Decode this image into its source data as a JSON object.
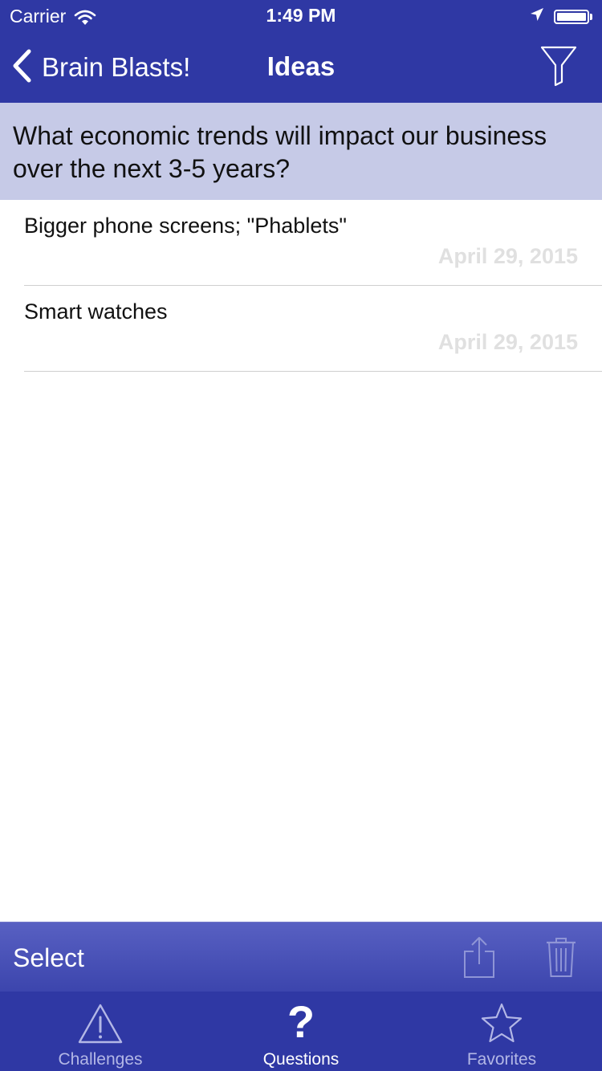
{
  "status_bar": {
    "carrier": "Carrier",
    "time": "1:49 PM",
    "battery_level": 1.0
  },
  "nav": {
    "back_label": "Brain Blasts!",
    "title": "Ideas"
  },
  "question": {
    "text": "What economic trends will impact our business over the next 3-5 years?"
  },
  "ideas": [
    {
      "text": "Bigger phone screens; \"Phablets\"",
      "date": "April 29, 2015"
    },
    {
      "text": "Smart watches",
      "date": "April 29, 2015"
    }
  ],
  "toolbar": {
    "select_label": "Select",
    "share_icon": "share-icon",
    "trash_icon": "trash-icon"
  },
  "tabs": [
    {
      "label": "Challenges",
      "icon": "warning-icon",
      "active": false
    },
    {
      "label": "Questions",
      "icon": "question-icon",
      "active": true
    },
    {
      "label": "Favorites",
      "icon": "star-icon",
      "active": false
    }
  ],
  "colors": {
    "primary": "#2f38a4",
    "banner": "#c6cae7",
    "toolbar": "#4a52b8",
    "date_text": "#e0e0e0",
    "inactive_tab": "#b3b7e6"
  }
}
